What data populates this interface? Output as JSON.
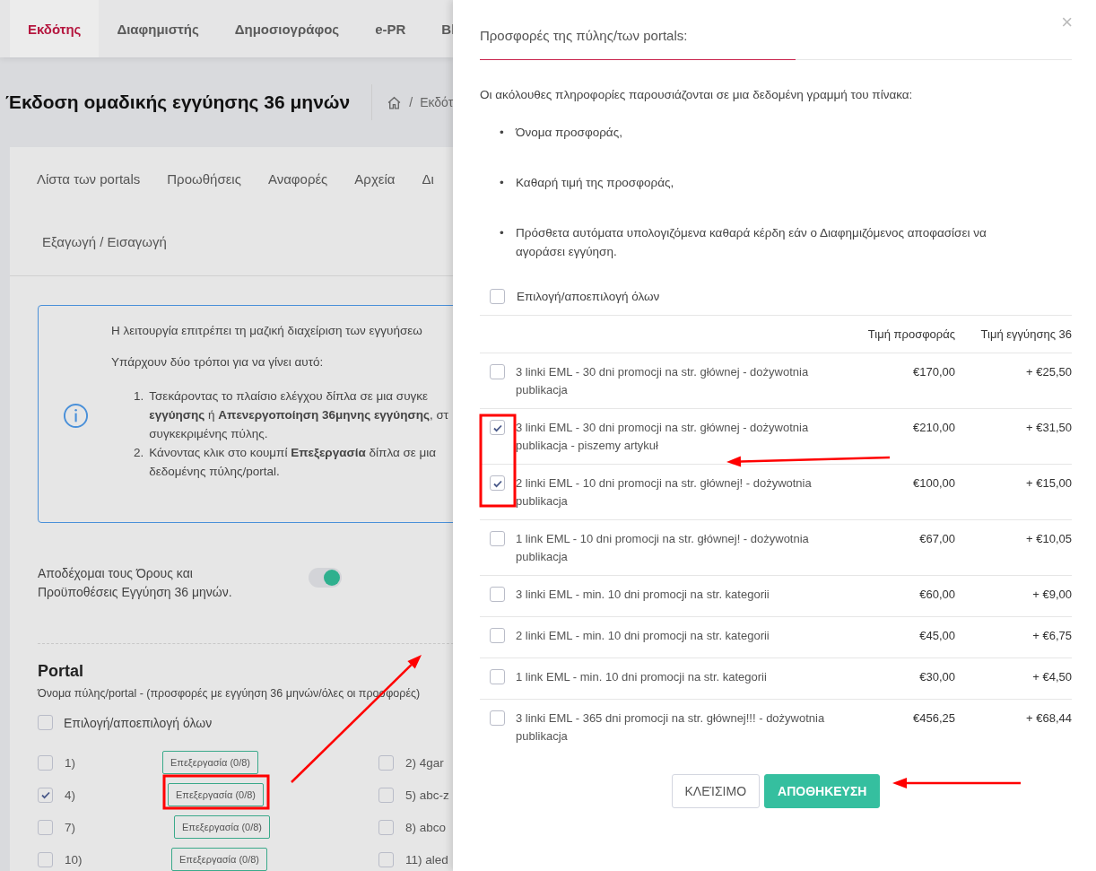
{
  "top_tabs": [
    {
      "label": "Εκδότης",
      "selected": true
    },
    {
      "label": "Διαφημιστής",
      "selected": false
    },
    {
      "label": "Δημοσιογράφος",
      "selected": false
    },
    {
      "label": "e-PR",
      "selected": false
    },
    {
      "label": "Bl",
      "selected": false
    }
  ],
  "page_title": "Έκδοση ομαδικής εγγύησης 36 μηνών",
  "breadcrumb": {
    "separator": "/",
    "current": "Εκδότ"
  },
  "sub_nav": [
    [
      "Λίστα των portals",
      "Προωθήσεις",
      "Αναφορές",
      "Αρχεία",
      "Δι"
    ],
    [
      "Εξαγωγή / Εισαγωγή"
    ]
  ],
  "info_box": {
    "intro": "Η λειτουργία επιτρέπει τη μαζική διαχείριση των εγγυήσεω",
    "ways": "Υπάρχουν δύο τρόποι για να γίνει αυτό:",
    "steps": [
      {
        "number": "1.",
        "lines": [
          "Τσεκάροντας το πλαίσιο ελέγχου δίπλα σε μια συγκε",
          "**εγγύησης** ή **Απενεργοποίηση 36μηνης εγγύησης**, στ",
          "συγκεκριμένης πύλης."
        ]
      },
      {
        "number": "2.",
        "lines": [
          "Κάνοντας κλικ στο κουμπί **Επεξεργασία** δίπλα σε μια",
          "δεδομένης πύλης/portal."
        ]
      }
    ]
  },
  "terms": {
    "label": "Αποδέχομαι τους Όρους και Προϋποθέσεις Εγγύηση 36 μηνών.",
    "on": true
  },
  "portal": {
    "heading": "Portal",
    "subtitle": "Όνομα πύλης/portal - (προσφορές με εγγύηση 36 μηνών/όλες οι προσφορές)",
    "select_all": {
      "label": "Επιλογή/αποεπιλογή όλων",
      "checked": false
    },
    "rows": [
      [
        {
          "label": "1)",
          "checked": false,
          "edit": "Επεξεργασία (0/8)"
        },
        {
          "label": "2) 4gar",
          "checked": false
        }
      ],
      [
        {
          "label": "4)",
          "checked": true,
          "edit": "Επεξεργασία (0/8)"
        },
        {
          "label": "5) abc-z",
          "checked": false
        }
      ],
      [
        {
          "label": "7)",
          "checked": false,
          "edit": "Επεξεργασία (0/8)"
        },
        {
          "label": "8) abco",
          "checked": false
        }
      ],
      [
        {
          "label": "10)",
          "checked": false,
          "edit": "Επεξεργασία (0/8)"
        },
        {
          "label": "11) aled",
          "checked": false
        }
      ]
    ]
  },
  "panel": {
    "close": "×",
    "title": "Προσφορές της πύλης/των portals:",
    "description": "Οι ακόλουθες πληροφορίες παρουσιάζονται σε μια δεδομένη γραμμή του πίνακα:",
    "bullets": [
      {
        "marker": "•",
        "text": "Όνομα προσφοράς,"
      },
      {
        "marker": "•",
        "text": "Καθαρή τιμή της προσφοράς,"
      },
      {
        "marker": "•",
        "text": "Πρόσθετα αυτόματα υπολογιζόμενα καθαρά κέρδη εάν ο Διαφημιζόμενος αποφασίσει να αγοράσει εγγύηση."
      }
    ],
    "select_all": {
      "label": "Επιλογή/αποεπιλογή όλων",
      "checked": false
    },
    "columns": [
      "Τιμή προσφοράς",
      "Τιμή εγγύησης 36"
    ],
    "offers": [
      {
        "name": "3 linki EML - 30 dni promocji na str. głównej - dożywotnia publikacja",
        "price": "€170,00",
        "guarantee": "+ €25,50",
        "checked": false
      },
      {
        "name": "3 linki EML - 30 dni promocji na str. głównej - dożywotnia publikacja - piszemy artykuł",
        "price": "€210,00",
        "guarantee": "+ €31,50",
        "checked": true
      },
      {
        "name": "2 linki EML - 10 dni promocji na str. głównej! - dożywotnia publikacja",
        "price": "€100,00",
        "guarantee": "+ €15,00",
        "checked": true
      },
      {
        "name": "1 link EML - 10 dni promocji na str. głównej! - dożywotnia publikacja",
        "price": "€67,00",
        "guarantee": "+ €10,05",
        "checked": false
      },
      {
        "name": "3 linki EML - min. 10 dni promocji na str. kategorii",
        "price": "€60,00",
        "guarantee": "+ €9,00",
        "checked": false
      },
      {
        "name": "2 linki EML - min. 10 dni promocji na str. kategorii",
        "price": "€45,00",
        "guarantee": "+ €6,75",
        "checked": false
      },
      {
        "name": "1 link EML - min. 10 dni promocji na str. kategorii",
        "price": "€30,00",
        "guarantee": "+ €4,50",
        "checked": false
      },
      {
        "name": "3 linki EML - 365 dni promocji na str. głównej!!! - dożywotnia publikacja",
        "price": "€456,25",
        "guarantee": "+ €68,44",
        "checked": false
      }
    ],
    "buttons": [
      {
        "label": "ΚΛΕΊΣΙΜΟ",
        "kind": "secondary"
      },
      {
        "label": "ΑΠΟΘΗΚΕΥΣΗ",
        "kind": "primary"
      }
    ]
  },
  "annotations": [
    {
      "kind": "box"
    },
    {
      "kind": "arrow"
    },
    {
      "kind": "box"
    },
    {
      "kind": "arrow"
    },
    {
      "kind": "arrow"
    }
  ]
}
